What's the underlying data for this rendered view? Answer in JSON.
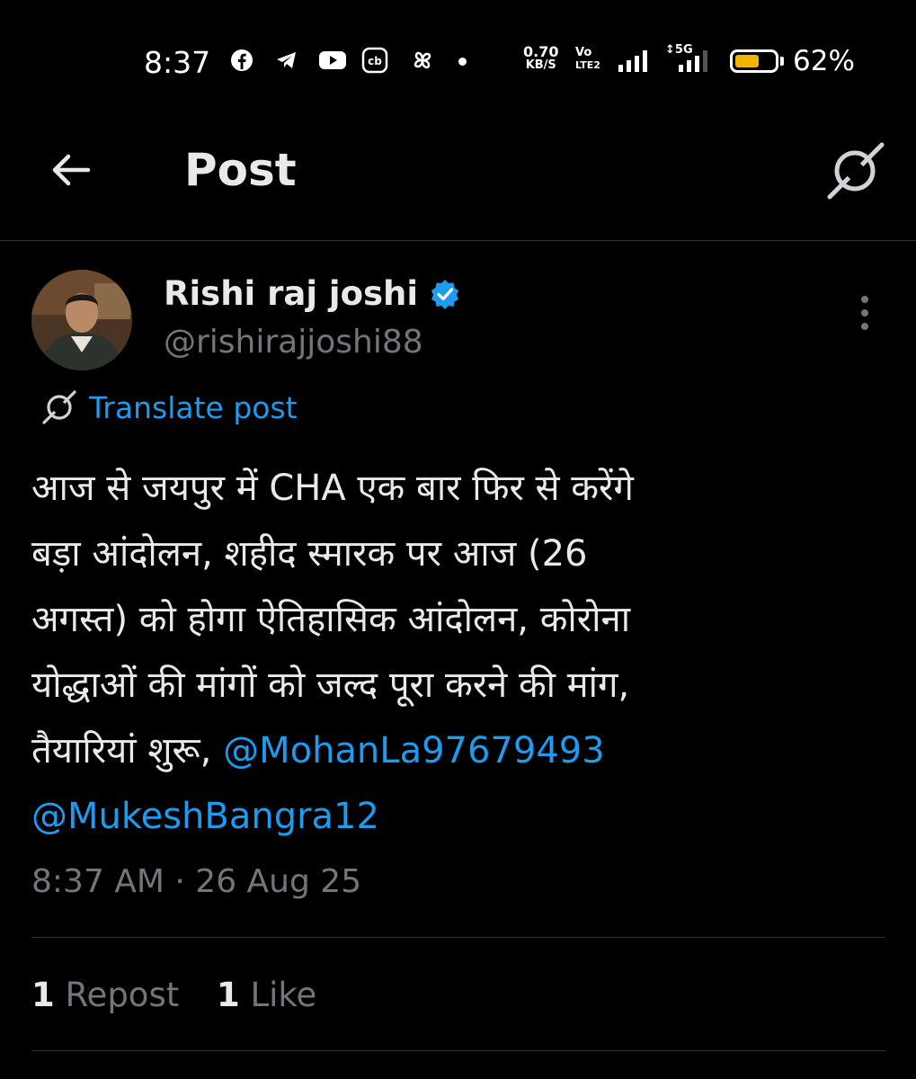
{
  "status_bar": {
    "time": "8:37",
    "icons": [
      "facebook-icon",
      "telegram-icon",
      "youtube-icon",
      "cb-icon",
      "pinwheel-icon",
      "dot"
    ],
    "net_speed_value": "0.70",
    "net_speed_unit": "KB/S",
    "volte_top": "Vo",
    "volte_bottom": "LTE2",
    "network": "5G",
    "battery_percent": "62%",
    "battery_level": 0.62
  },
  "header": {
    "title": "Post",
    "back_icon": "arrow-left-icon",
    "grok_icon": "grok-icon"
  },
  "post": {
    "author_name": "Rishi raj joshi",
    "handle": "@rishirajjoshi88",
    "verified": true,
    "translate_label": "Translate post",
    "lines": [
      "आज से जयपुर में CHA एक बार फिर से करेंगे",
      "बड़ा आंदोलन, शहीद स्मारक पर आज (26",
      "अगस्त) को होगा ऐतिहासिक आंदोलन, कोरोना",
      "योद्धाओं की मांगों को जल्द पूरा करने की मांग,",
      "तैयारियां शुरू,"
    ],
    "mention_1": "@MohanLa97679493",
    "mention_2": "@MukeshBangra12",
    "timestamp": "8:37 AM · 26 Aug 25",
    "repost_count": "1",
    "repost_label": "Repost",
    "like_count": "1",
    "like_label": "Like"
  },
  "colors": {
    "background": "#000000",
    "text": "#e7e9ea",
    "muted": "#71767b",
    "accent": "#1d9bf0",
    "battery": "#f0b500"
  }
}
